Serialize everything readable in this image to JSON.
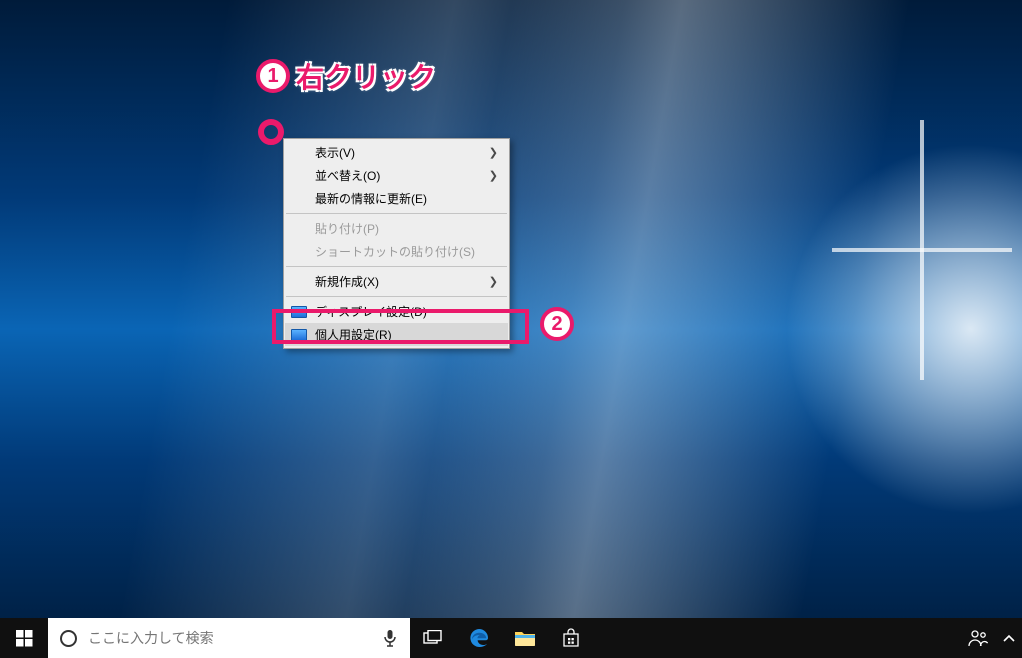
{
  "annotations": {
    "step1_number": "1",
    "step1_text": "右クリック",
    "step2_number": "2"
  },
  "context_menu": {
    "items": [
      {
        "label": "表示(V)",
        "has_submenu": true,
        "enabled": true
      },
      {
        "label": "並べ替え(O)",
        "has_submenu": true,
        "enabled": true
      },
      {
        "label": "最新の情報に更新(E)",
        "has_submenu": false,
        "enabled": true
      }
    ],
    "items2": [
      {
        "label": "貼り付け(P)",
        "has_submenu": false,
        "enabled": false
      },
      {
        "label": "ショートカットの貼り付け(S)",
        "has_submenu": false,
        "enabled": false
      }
    ],
    "items3": [
      {
        "label": "新規作成(X)",
        "has_submenu": true,
        "enabled": true
      }
    ],
    "items4": [
      {
        "label": "ディスプレイ設定(D)",
        "has_submenu": false,
        "enabled": true,
        "icon": true
      },
      {
        "label": "個人用設定(R)",
        "has_submenu": false,
        "enabled": true,
        "icon": true,
        "highlighted": true
      }
    ]
  },
  "taskbar": {
    "search_placeholder": "ここに入力して検索"
  },
  "colors": {
    "annotation": "#ea1a6b",
    "taskbar": "#101010",
    "menu_bg": "#eeeeee"
  }
}
